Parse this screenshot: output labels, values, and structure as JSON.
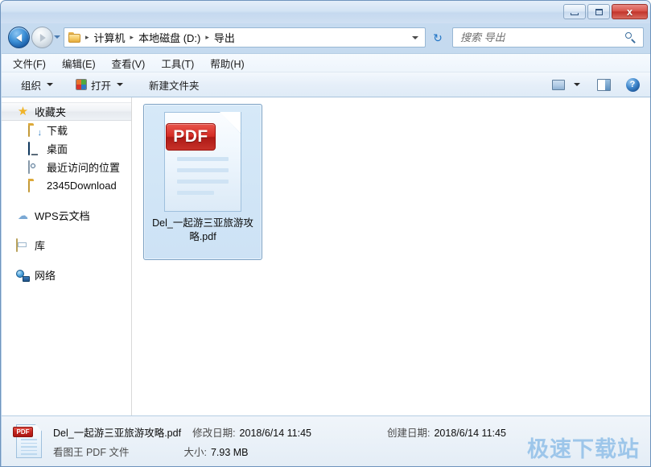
{
  "window": {
    "buttons": {
      "minimize_label": "",
      "maximize_label": "",
      "close_label": "x"
    }
  },
  "navigation": {
    "back_tooltip": "back",
    "forward_tooltip": "forward",
    "history_tooltip": "recent pages",
    "refresh_glyph": "↻"
  },
  "address": {
    "crumbs": [
      "计算机",
      "本地磁盘 (D:)",
      "导出"
    ],
    "separator": "▸"
  },
  "search": {
    "placeholder": "搜索 导出",
    "value": ""
  },
  "menubar": {
    "items": [
      {
        "label": "文件(F)"
      },
      {
        "label": "编辑(E)"
      },
      {
        "label": "查看(V)"
      },
      {
        "label": "工具(T)"
      },
      {
        "label": "帮助(H)"
      }
    ]
  },
  "toolbar": {
    "organize_label": "组织",
    "open_label": "打开",
    "new_folder_label": "新建文件夹",
    "help_glyph": "?"
  },
  "navpane": {
    "groups": [
      {
        "label": "收藏夹",
        "icon": "star-icon",
        "highlight": true,
        "children": [
          {
            "label": "下载",
            "icon": "download-folder-icon"
          },
          {
            "label": "桌面",
            "icon": "desktop-icon"
          },
          {
            "label": "最近访问的位置",
            "icon": "recent-places-icon"
          },
          {
            "label": "2345Download",
            "icon": "folder-icon"
          }
        ]
      },
      {
        "label": "WPS云文档",
        "icon": "cloud-icon",
        "children": []
      },
      {
        "label": "库",
        "icon": "library-icon",
        "children": []
      },
      {
        "label": "网络",
        "icon": "network-icon",
        "children": []
      }
    ]
  },
  "files": [
    {
      "name": "Del_一起游三亚旅游攻略.pdf",
      "icon_badge": "PDF",
      "selected": true
    }
  ],
  "details": {
    "name": "Del_一起游三亚旅游攻略.pdf",
    "type": "看图王 PDF 文件",
    "modified_label": "修改日期:",
    "modified_value": "2018/6/14 11:45",
    "size_label": "大小:",
    "size_value": "7.93 MB",
    "created_label": "创建日期:",
    "created_value": "2018/6/14 11:45",
    "badge": "PDF"
  },
  "watermark": {
    "text": "极速下载站"
  },
  "colors": {
    "frame": "#b4cee8",
    "selection_bg": "#cde2f5",
    "selection_border": "#7da2c4",
    "pdf_red": "#c4241e",
    "watermark_blue": "#9dc6ea",
    "accent_blue": "#2175c6"
  }
}
